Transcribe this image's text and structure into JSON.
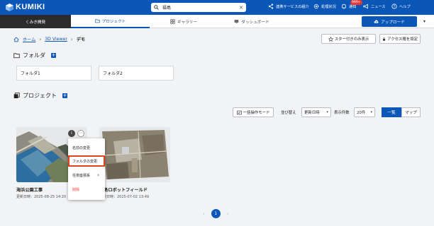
{
  "header": {
    "logo_text": "KUMIKI",
    "search": {
      "value": "福島",
      "clear": "✕"
    },
    "nav": {
      "linked_services": "連携サービスの紹介",
      "processing_status": "処理状況",
      "notifications": "通知",
      "notifications_badge": "999+",
      "news": "ニュース",
      "help": "ヘルプ"
    }
  },
  "tabs": {
    "project_name": "くみき開発",
    "items": [
      "プロジェクト",
      "ギャラリー",
      "ダッシュボード"
    ],
    "upload": "アップロード",
    "upload_caret": "▾"
  },
  "breadcrumb": {
    "home": "ホーム",
    "sep1": "›",
    "viewer": "3D Viewer",
    "sep2": "›",
    "current": "デモ"
  },
  "actions": {
    "starred_only": "スター付きのみ表示",
    "access_settings": "アクセス権を設定"
  },
  "folders": {
    "heading": "フォルダ",
    "plus": "+",
    "items": [
      "フォルダ1",
      "フォルダ2"
    ]
  },
  "projects": {
    "heading": "プロジェクト",
    "plus": "+",
    "toolbar": {
      "bulk_mode": "一括操作モード",
      "sort_label": "並び替え",
      "sort_value": "更新日時",
      "count_label": "表示件数",
      "count_value": "20件",
      "caret": "▾",
      "list_view": "一覧",
      "map_view": "マップ"
    },
    "cards": [
      {
        "title": "海浜公園工事",
        "date": "更新日時：2025-08-25 14:20"
      },
      {
        "title": "福島ロボットフィールド",
        "date": "更新日時：2025-07-02 13:49"
      }
    ],
    "card_icons": {
      "info": "i",
      "more": "⋯"
    }
  },
  "context_menu": {
    "rename": "名前の変更",
    "change_folder": "フォルダの変更",
    "coordinate_system": "任意座標系",
    "coordinate_arrow": "›",
    "delete": "削除"
  },
  "pagination": {
    "prev": "‹",
    "current": "1",
    "next": "›"
  },
  "colors": {
    "brand": "#0b57b8",
    "danger": "#e53935",
    "highlight_border": "#e0441c"
  }
}
